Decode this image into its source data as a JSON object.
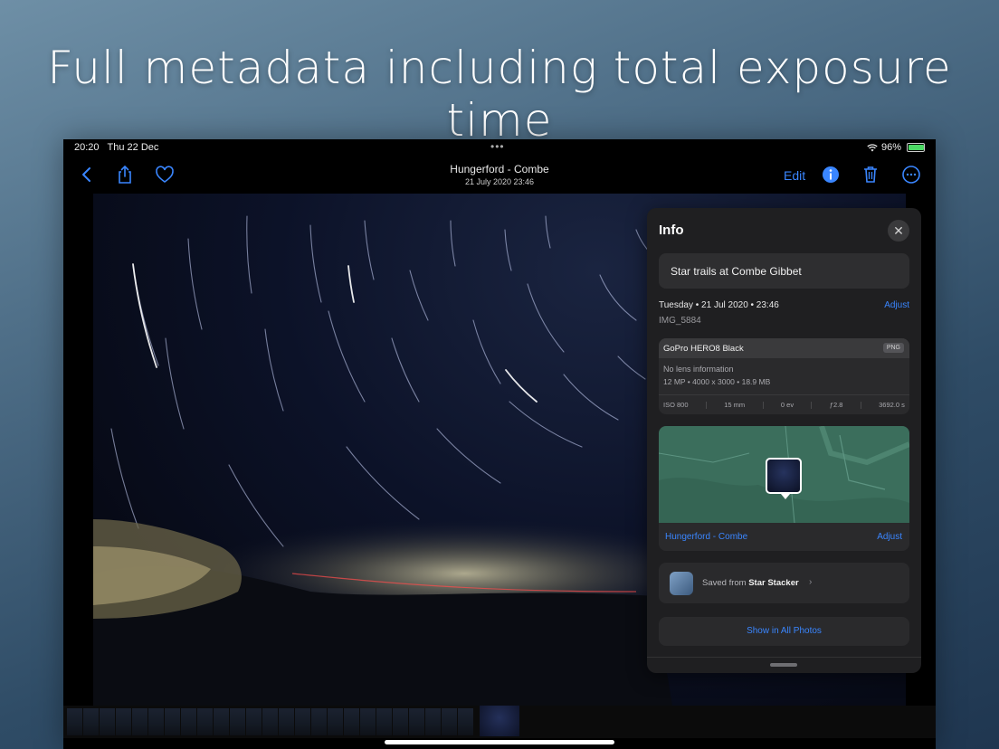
{
  "headline": "Full metadata including total exposure time",
  "status_bar": {
    "time": "20:20",
    "date": "Thu 22 Dec",
    "battery": "96%",
    "dots": "•••"
  },
  "nav": {
    "title": "Hungerford - Combe",
    "subtitle": "21 July 2020  23:46",
    "edit_label": "Edit"
  },
  "info_panel": {
    "title": "Info",
    "caption": "Star trails at Combe Gibbet",
    "date_line": "Tuesday • 21 Jul 2020 • 23:46",
    "adjust_label": "Adjust",
    "image_name": "IMG_5884",
    "camera": {
      "name": "GoPro HERO8 Black",
      "format": "PNG",
      "lens": "No lens information",
      "specs": "12 MP  •  4000 x 3000  •  18.9 MB",
      "exif": [
        "ISO 800",
        "15 mm",
        "0 ev",
        "ƒ2.8",
        "3692.0 s"
      ]
    },
    "map": {
      "location": "Hungerford - Combe",
      "adjust_label": "Adjust"
    },
    "saved_from": {
      "prefix": "Saved from",
      "app": "Star Stacker",
      "chevron": "›"
    },
    "show_all_label": "Show in All Photos"
  },
  "icons": {
    "back": "chevron-left-icon",
    "share": "share-icon",
    "favorite": "heart-icon",
    "info": "info-icon",
    "delete": "trash-icon",
    "more": "ellipsis-circle-icon",
    "close": "close-icon",
    "wifi": "wifi-icon",
    "battery": "battery-icon"
  },
  "colors": {
    "accent": "#3a86ff",
    "panel_bg": "#1f1f21",
    "map_green": "#3b6e5c"
  }
}
